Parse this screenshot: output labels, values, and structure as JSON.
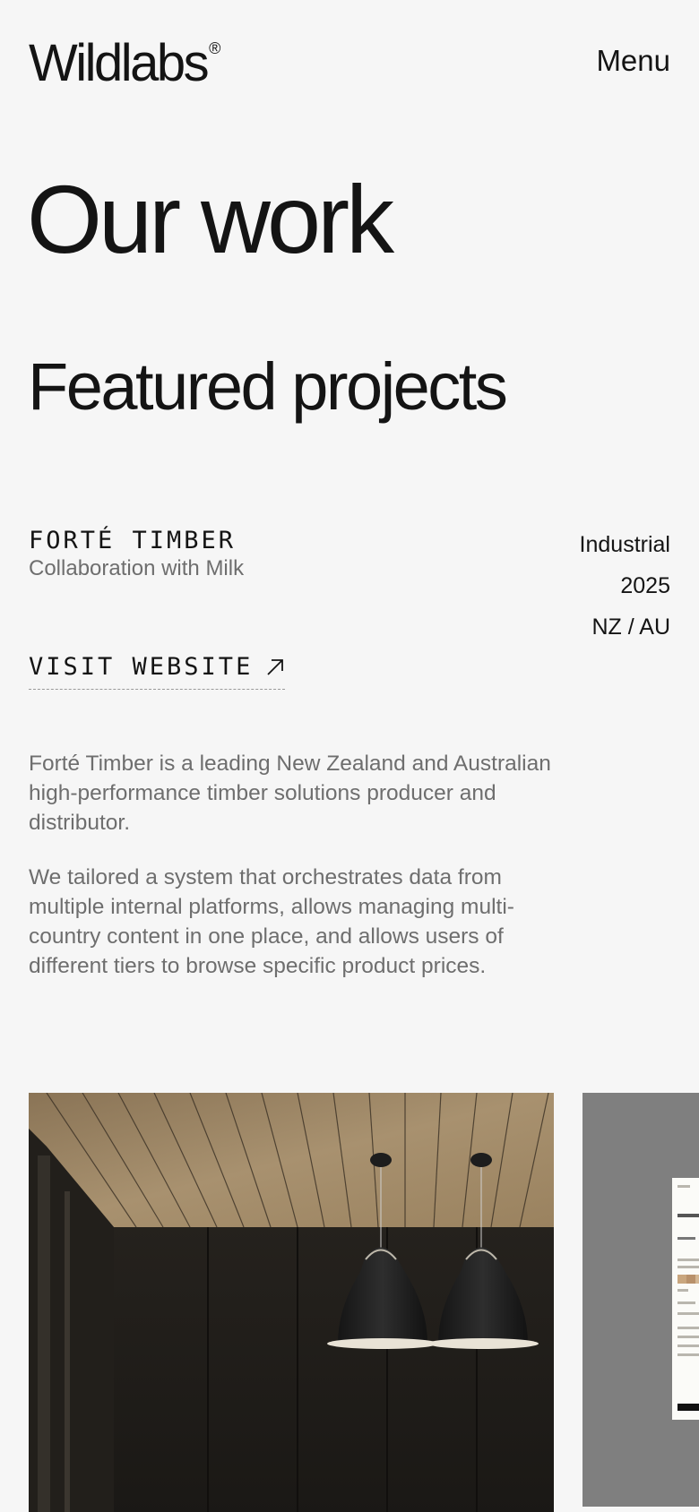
{
  "header": {
    "logo": "Wildlabs",
    "logo_mark": "®",
    "menu_label": "Menu"
  },
  "page_title": "Our work",
  "section_title": "Featured projects",
  "project": {
    "title": "FORTÉ TIMBER",
    "subtitle": "Collaboration with Milk",
    "category": "Industrial",
    "year": "2025",
    "region": "NZ / AU",
    "link_label": "VISIT WEBSITE",
    "link_icon": "arrow-up-right-icon",
    "description": [
      "Forté Timber is a leading New Zealand and Australian high-performance timber solutions producer and distributor.",
      "We tailored a system that orchestrates data from multiple internal platforms, allows managing multi-country content in one place, and allows users of different tiers to browse specific product prices."
    ]
  },
  "colors": {
    "background": "#f6f6f6",
    "text": "#141414",
    "muted": "#6e6e6e"
  }
}
